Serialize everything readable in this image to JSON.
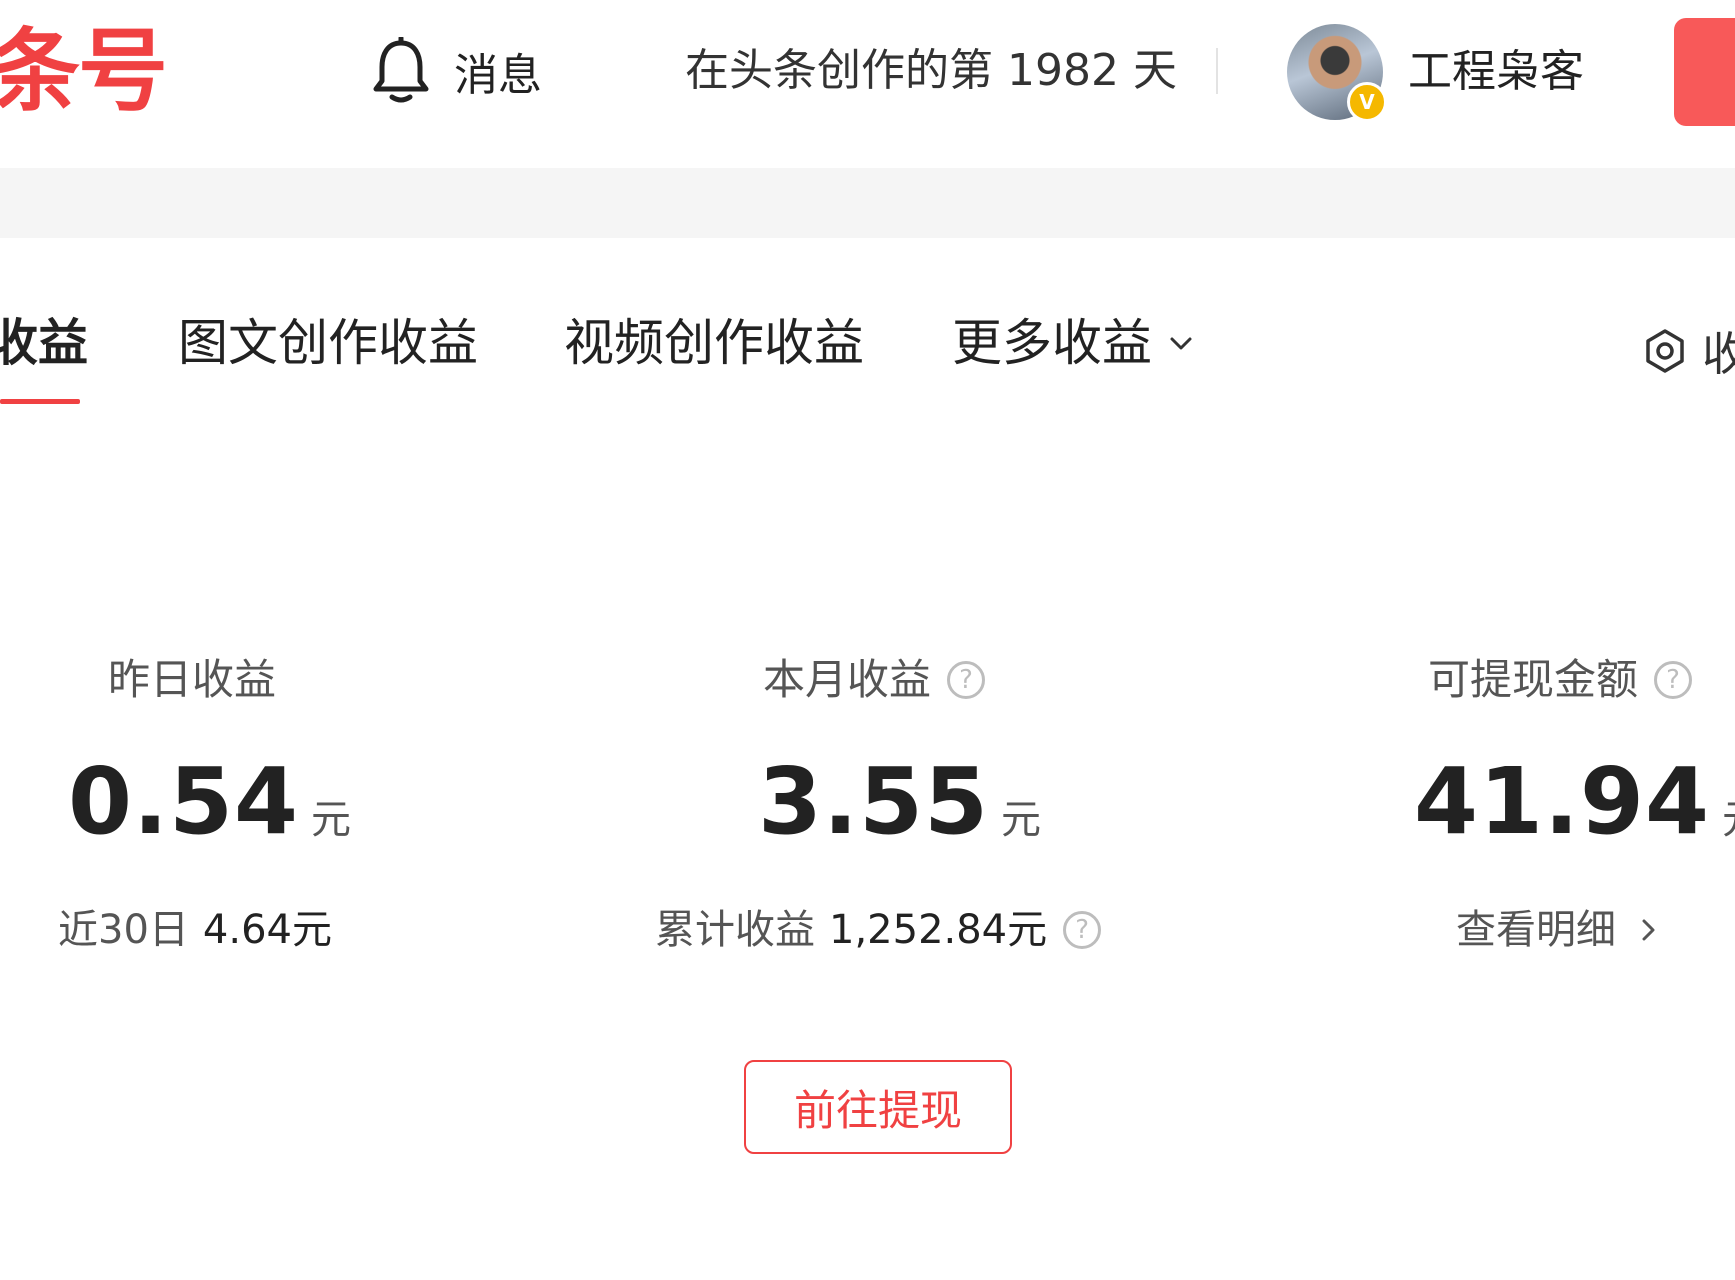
{
  "header": {
    "logo_text": "条号",
    "messages_label": "消息",
    "creation_days": "在头条创作的第 1982 天",
    "username": "工程枭客",
    "verified_badge": "V"
  },
  "tabs": {
    "items": [
      {
        "label": "收益",
        "active": true
      },
      {
        "label": "图文创作收益",
        "active": false
      },
      {
        "label": "视频创作收益",
        "active": false
      },
      {
        "label": "更多收益",
        "active": false,
        "dropdown": true
      }
    ],
    "right_label": "收"
  },
  "stats": {
    "yesterday": {
      "label": "昨日收益",
      "value": "0.54",
      "unit": "元",
      "sub_label": "近30日",
      "sub_value": "4.64元"
    },
    "month": {
      "label": "本月收益",
      "value": "3.55",
      "unit": "元",
      "sub_label": "累计收益",
      "sub_value": "1,252.84元"
    },
    "withdrawable": {
      "label": "可提现金额",
      "value": "41.94",
      "unit": "元",
      "detail_link": "查看明细"
    }
  },
  "withdraw_button": "前往提现",
  "icons": {
    "bell": "bell-icon",
    "help": "help-icon",
    "chevron_down": "chevron-down-icon",
    "chevron_right": "chevron-right-icon",
    "settings": "gear-icon"
  },
  "colors": {
    "brand_red": "#f04142",
    "header_button": "#f85959",
    "badge": "#f5b800"
  }
}
